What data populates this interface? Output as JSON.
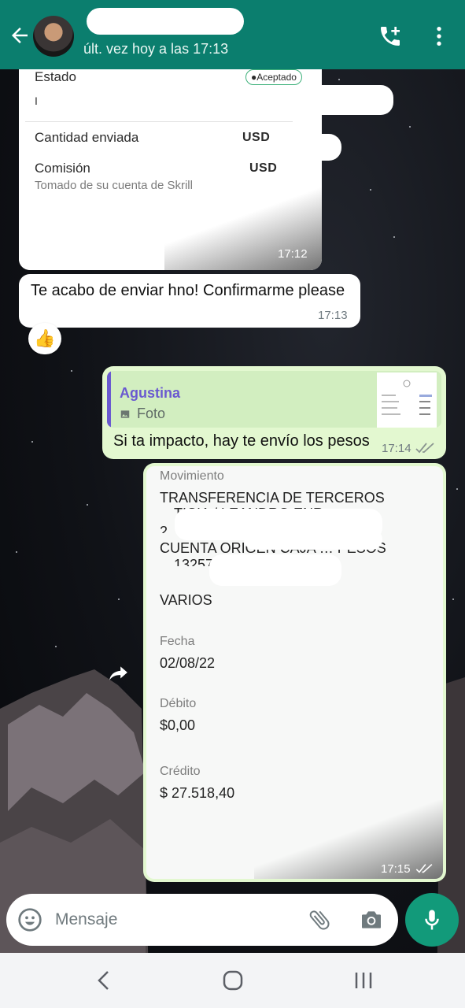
{
  "header": {
    "last_seen": "últ. vez hoy a las 17:13",
    "icons": [
      "back-arrow-icon",
      "add-call-icon",
      "more-vert-icon"
    ]
  },
  "messages": {
    "payment_card": {
      "status_label": "Estado",
      "status_badge": "●Aceptado",
      "partial_label": "I",
      "amount_label": "Cantidad enviada",
      "amount_currency": "USD",
      "fee_label": "Comisión",
      "fee_currency": "USD",
      "fee_note": "Tomado de su cuenta de Skrill",
      "time": "17:12"
    },
    "text1": {
      "text": "Te acabo de enviar hno! Confirmarme please",
      "time": "17:13",
      "reaction": "👍"
    },
    "reply": {
      "quote_author": "Agustina",
      "quote_type": "Foto",
      "text": "Si ta impacto, hay te envío los pesos",
      "time": "17:14"
    },
    "bank_image": {
      "movement_label": "Movimiento",
      "movement_value": "TRANSFERENCIA DE TERCEROS",
      "partial_line1": "…TICIA / LEANDRO ENR",
      "partial_line2": "2…",
      "account_line": "CUENTA ORIGEN CAJA … PESOS",
      "partial_line3": "…13257…0",
      "varios": "VARIOS",
      "date_label": "Fecha",
      "date_value": "02/08/22",
      "debit_label": "Débito",
      "debit_value": "$0,00",
      "credit_label": "Crédito",
      "credit_value": "$ 27.518,40",
      "time": "17:15"
    }
  },
  "composer": {
    "placeholder": "Mensaje"
  },
  "colors": {
    "header": "#0b7e6e",
    "outgoing": "#e3f8d0",
    "incoming": "#ffffff",
    "mic": "#129a7a",
    "quote_accent": "#6a5ad0"
  }
}
